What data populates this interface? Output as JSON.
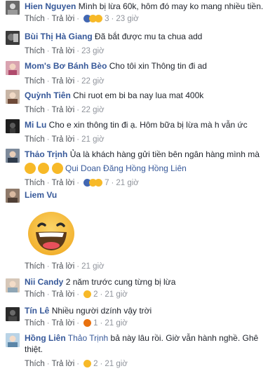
{
  "ui": {
    "like_label": "Thích",
    "reply_label": "Trả lời",
    "separator": "·"
  },
  "comments": [
    {
      "author": "Hien Nguyen",
      "text": "Mình bị lừa 60k, hôm đó may ko mang nhiều tiền.",
      "reaction_count": "3",
      "time": "23 giờ"
    },
    {
      "author": "Bùi Thị Hà Giang",
      "text": "Đã bắt được mu ta chua add",
      "time": "23 giờ"
    },
    {
      "author": "Mom's Bơ Bánh Bèo",
      "text": "Cho tôi xin Thông tin đi ad",
      "time": "22 giờ"
    },
    {
      "author": "Quỳnh Tiên",
      "text": "Chi ruot em bi ba nay lua mat 400k",
      "time": "22 giờ"
    },
    {
      "author": "Mi Lu",
      "text": "Cho e xin thông tin đi ạ. Hôm bữa bị lừa mà h vẫn ức",
      "time": "21 giờ"
    },
    {
      "author": "Thảo Trịnh",
      "text": "Ủa là khách hàng gửi tiền bên ngân hàng mình mà",
      "tagged": "Qui Doan Đăng Hồng Hồng Liên",
      "reaction_count": "7",
      "time": "21 giờ"
    },
    {
      "author": "Liem Vu",
      "text": "",
      "time": "21 giờ"
    },
    {
      "author": "Nii Candy",
      "text": "2 năm trước cung từng bị lừa",
      "reaction_count": "2",
      "time": "21 giờ"
    },
    {
      "author": "Tín Lê",
      "text": "Nhiều người dzính vậy trời",
      "reaction_count": "1",
      "time": "21 giờ"
    },
    {
      "author": "Hồng Liên",
      "tag": "Thảo Trịnh",
      "text": "bả này lâu rồi. Giờ vẫn hành nghề. Ghê thiệt.",
      "reaction_count": "2",
      "time": "21 giờ"
    }
  ],
  "colors": {
    "author": "#365899",
    "meta": "#90949c",
    "text": "#1d2129",
    "haha": "#f7b928",
    "angry": "#e9710f"
  }
}
